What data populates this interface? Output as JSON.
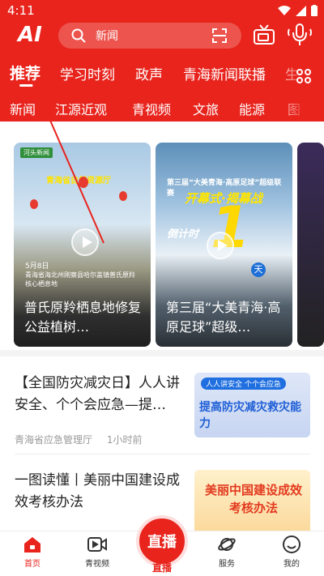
{
  "status_bar": {
    "time": "4:11"
  },
  "header": {
    "logo": "AI",
    "search_placeholder": "新闻",
    "primary_tabs": [
      {
        "label": "推荐",
        "active": true
      },
      {
        "label": "学习时刻"
      },
      {
        "label": "政声"
      },
      {
        "label": "青海新闻联播"
      },
      {
        "label": "生"
      }
    ],
    "secondary_tabs": [
      "新闻",
      "江源近观",
      "青视频",
      "文旅",
      "能源",
      "图"
    ]
  },
  "video_cards": [
    {
      "title": "普氏原羚栖息地修复公益植树…",
      "stamp": "河头新闻",
      "banner": "青海省自然资源厅",
      "date": "5月8日",
      "caption": "青海省海北州刚察县哈尔盖镇普氏原羚核心栖息地"
    },
    {
      "title": "第三届“大美青海·高原足球”超级…",
      "subtitle": "第三届“大美青海·高原足球”超级联赛",
      "headline": "开幕式·揭幕战",
      "countdown": "倒计时",
      "number": "1",
      "badge": "天"
    },
    {
      "title": ""
    }
  ],
  "news_items": [
    {
      "title": "【全国防灾减灾日】人人讲安全、个个会应急—提…",
      "source": "青海省应急管理厅",
      "time": "1小时前",
      "thumb_tag": "人人讲安全 个个会应急",
      "thumb_text": "提高防灾减灾救灾能力"
    },
    {
      "title": "一图读懂丨美丽中国建设成效考核办法",
      "thumb_text": "美丽中国建设成效考核办法"
    }
  ],
  "bottom_nav": {
    "items": [
      {
        "label": "首页",
        "active": true
      },
      {
        "label": "青视频"
      },
      {
        "label": "直播"
      },
      {
        "label": "服务"
      },
      {
        "label": "我的"
      }
    ],
    "live_button_text": "直播"
  },
  "colors": {
    "brand_red": "#e8241d"
  }
}
